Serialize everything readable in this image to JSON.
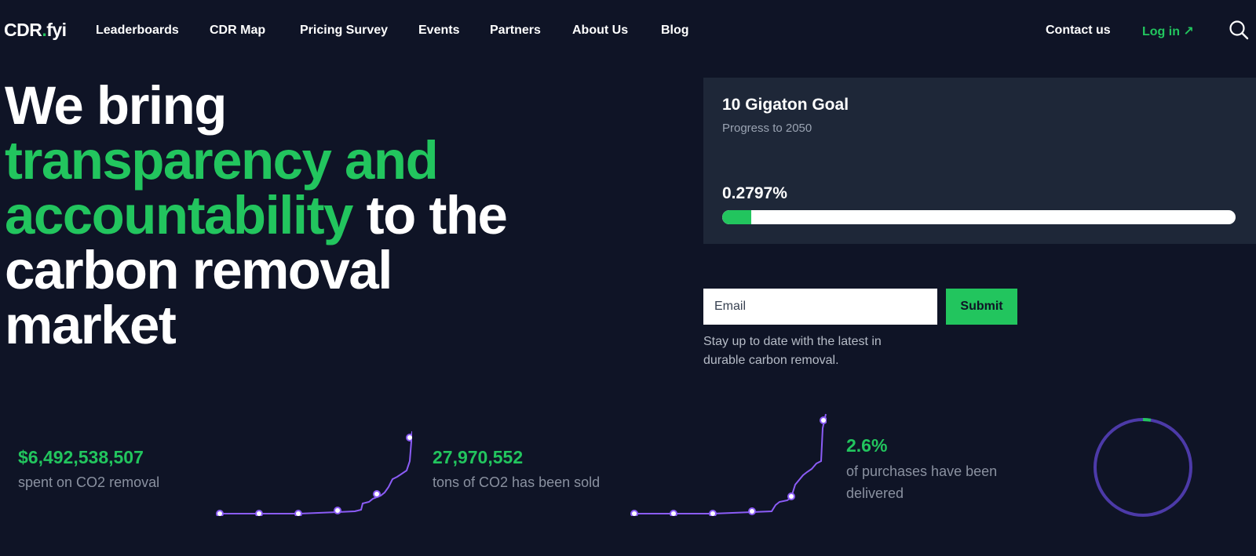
{
  "nav": {
    "logo_main": "CDR",
    "logo_dot": ".",
    "logo_suffix": "fyi",
    "items": [
      "Leaderboards",
      "CDR Map",
      "Pricing Survey",
      "Events",
      "Partners",
      "About Us",
      "Blog"
    ],
    "contact_label": "Contact us",
    "login_label": "Log in ↗"
  },
  "hero": {
    "line1": "We bring",
    "highlight1": "transparency and",
    "highlight2": "accountability",
    "rest2": " to the",
    "line4": "carbon removal",
    "line5": "market"
  },
  "goal": {
    "title": "10 Gigaton Goal",
    "subtitle": "Progress to 2050",
    "percent_text": "0.2797%",
    "progress_fraction": 0.057
  },
  "newsletter": {
    "placeholder": "Email",
    "submit_label": "Submit",
    "note": "Stay up to date with the latest in durable carbon removal."
  },
  "stats": [
    {
      "value": "$6,492,538,507",
      "label": "spent on CO2 removal"
    },
    {
      "value": "27,970,552",
      "label": "tons of CO2 has been sold"
    },
    {
      "value": "2.6%",
      "label_line1": "of purchases have been",
      "label_line2": "delivered"
    }
  ],
  "colors": {
    "background": "#0f1426",
    "accent_green": "#22c55e",
    "card": "#1e2738",
    "spark_purple": "#8b5cf6",
    "ring_purple": "#4c3aa8"
  },
  "icons": {
    "search": "search-icon",
    "external": "arrow-up-right-icon"
  }
}
